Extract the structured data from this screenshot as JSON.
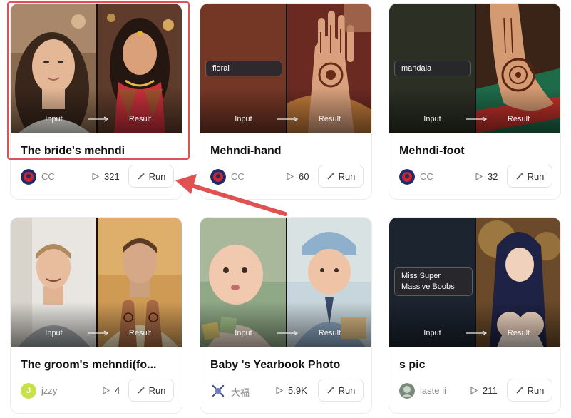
{
  "common": {
    "input_label": "Input",
    "result_label": "Result",
    "run_label": "Run"
  },
  "cards": [
    {
      "title": "The bride's mehndi",
      "author": "CC",
      "runs": "321",
      "prompt": ""
    },
    {
      "title": "Mehndi-hand",
      "author": "CC",
      "runs": "60",
      "prompt": "floral"
    },
    {
      "title": "Mehndi-foot",
      "author": "CC",
      "runs": "32",
      "prompt": "mandala"
    },
    {
      "title": "The groom's mehndi(fo...",
      "author": "jzzy",
      "avatar_letter": "J",
      "runs": "4",
      "prompt": ""
    },
    {
      "title": "Baby 's Yearbook Photo",
      "author": "大福",
      "runs": "5.9K",
      "prompt": ""
    },
    {
      "title": "s pic",
      "author": "laste li",
      "runs": "211",
      "prompt_line1": "Miss Super",
      "prompt_line2": "Massive Boobs"
    }
  ],
  "colors": {
    "highlight": "#e05252",
    "accent_yellow": "#c8e04a"
  },
  "icons": [
    "play-icon",
    "wand-icon",
    "arrow-right-icon"
  ]
}
